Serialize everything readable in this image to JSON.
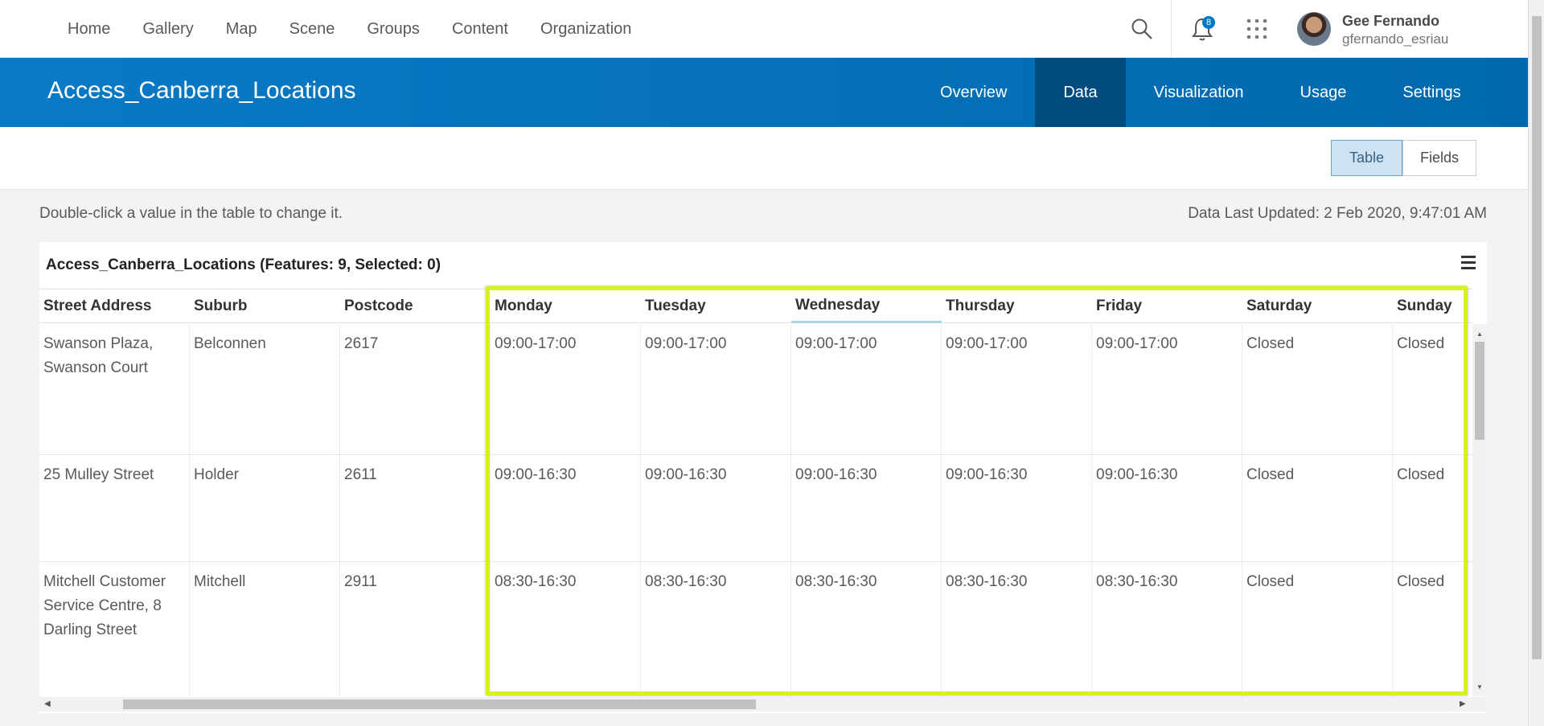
{
  "nav": {
    "links": [
      "Home",
      "Gallery",
      "Map",
      "Scene",
      "Groups",
      "Content",
      "Organization"
    ],
    "notification_count": "8",
    "user_name": "Gee Fernando",
    "user_handle": "gfernando_esriau"
  },
  "header": {
    "title": "Access_Canberra_Locations",
    "tabs": [
      "Overview",
      "Data",
      "Visualization",
      "Usage",
      "Settings"
    ],
    "active_tab": "Data"
  },
  "toolbar": {
    "table_label": "Table",
    "fields_label": "Fields"
  },
  "info": {
    "hint": "Double-click a value in the table to change it.",
    "last_updated": "Data Last Updated: 2 Feb 2020, 9:47:01 AM"
  },
  "table": {
    "title": "Access_Canberra_Locations (Features: 9, Selected: 0)",
    "columns": [
      "Street Address",
      "Suburb",
      "Postcode",
      "Monday",
      "Tuesday",
      "Wednesday",
      "Thursday",
      "Friday",
      "Saturday",
      "Sunday"
    ],
    "rows": [
      [
        "Swanson Plaza, Swanson Court",
        "Belconnen",
        "2617",
        "09:00-17:00",
        "09:00-17:00",
        "09:00-17:00",
        "09:00-17:00",
        "09:00-17:00",
        "Closed",
        "Closed"
      ],
      [
        "25 Mulley Street",
        "Holder",
        "2611",
        "09:00-16:30",
        "09:00-16:30",
        "09:00-16:30",
        "09:00-16:30",
        "09:00-16:30",
        "Closed",
        "Closed"
      ],
      [
        "Mitchell Customer Service Centre, 8 Darling Street",
        "Mitchell",
        "2911",
        "08:30-16:30",
        "08:30-16:30",
        "08:30-16:30",
        "08:30-16:30",
        "08:30-16:30",
        "Closed",
        "Closed"
      ]
    ]
  },
  "colors": {
    "banner": "#0a7ac6",
    "active_tab": "#004c80",
    "highlight": "#d8ef24"
  }
}
